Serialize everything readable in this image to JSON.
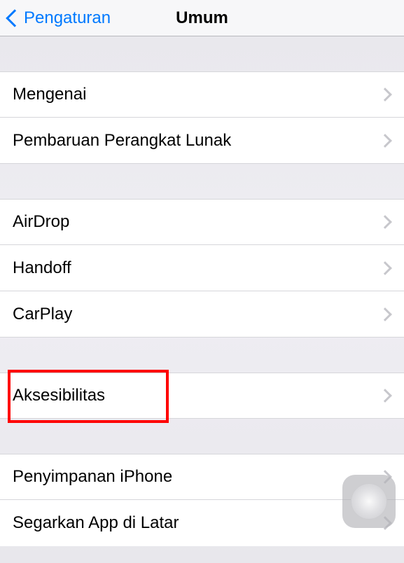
{
  "navbar": {
    "back_label": "Pengaturan",
    "title": "Umum"
  },
  "sections": [
    {
      "rows": [
        {
          "label": "Mengenai"
        },
        {
          "label": "Pembaruan Perangkat Lunak"
        }
      ]
    },
    {
      "rows": [
        {
          "label": "AirDrop"
        },
        {
          "label": "Handoff"
        },
        {
          "label": "CarPlay"
        }
      ]
    },
    {
      "rows": [
        {
          "label": "Aksesibilitas",
          "highlighted": true
        }
      ]
    },
    {
      "rows": [
        {
          "label": "Penyimpanan iPhone"
        },
        {
          "label": "Segarkan App di Latar"
        }
      ]
    }
  ]
}
